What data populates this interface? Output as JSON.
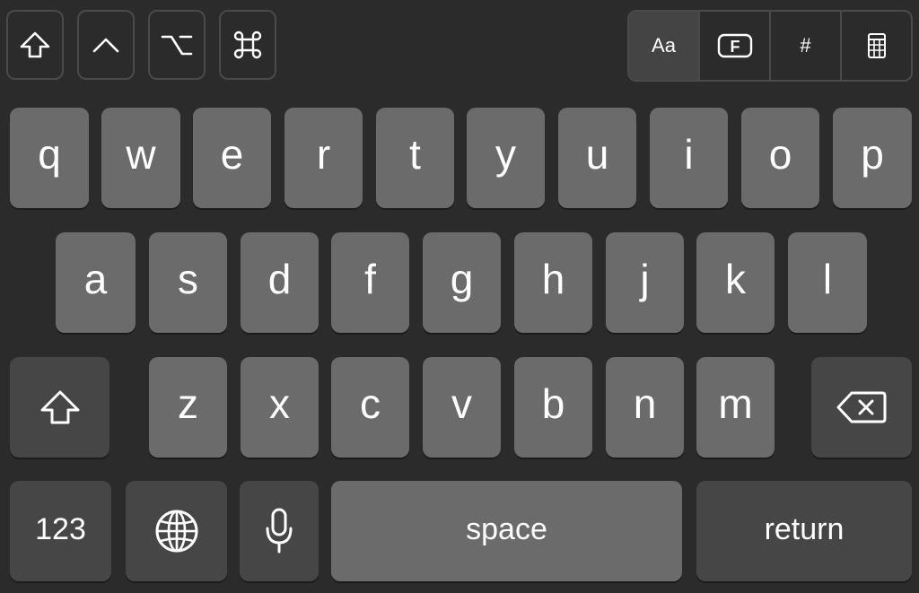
{
  "toolbar": {
    "modifiers": [
      {
        "name": "shift",
        "icon": "shift-outline-icon"
      },
      {
        "name": "control",
        "icon": "control-caret-icon",
        "glyph": "^"
      },
      {
        "name": "option",
        "icon": "option-icon",
        "glyph": "⌥"
      },
      {
        "name": "command",
        "icon": "command-icon",
        "glyph": "⌘"
      }
    ],
    "layout_modes": [
      {
        "label": "Aa",
        "active": true
      },
      {
        "label": "F",
        "icon": "function-keys-icon",
        "active": false
      },
      {
        "label": "#",
        "active": false
      },
      {
        "label": "",
        "icon": "keypad-icon",
        "active": false
      }
    ]
  },
  "keys": {
    "row1": [
      "q",
      "w",
      "e",
      "r",
      "t",
      "y",
      "u",
      "i",
      "o",
      "p"
    ],
    "row2": [
      "a",
      "s",
      "d",
      "f",
      "g",
      "h",
      "j",
      "k",
      "l"
    ],
    "row3": [
      "z",
      "x",
      "c",
      "v",
      "b",
      "n",
      "m"
    ],
    "numbers_label": "123",
    "space_label": "space",
    "return_label": "return"
  },
  "colors": {
    "background": "#2b2b2b",
    "key": "#6b6b6b",
    "special_key": "#464646",
    "text": "#ffffff"
  }
}
